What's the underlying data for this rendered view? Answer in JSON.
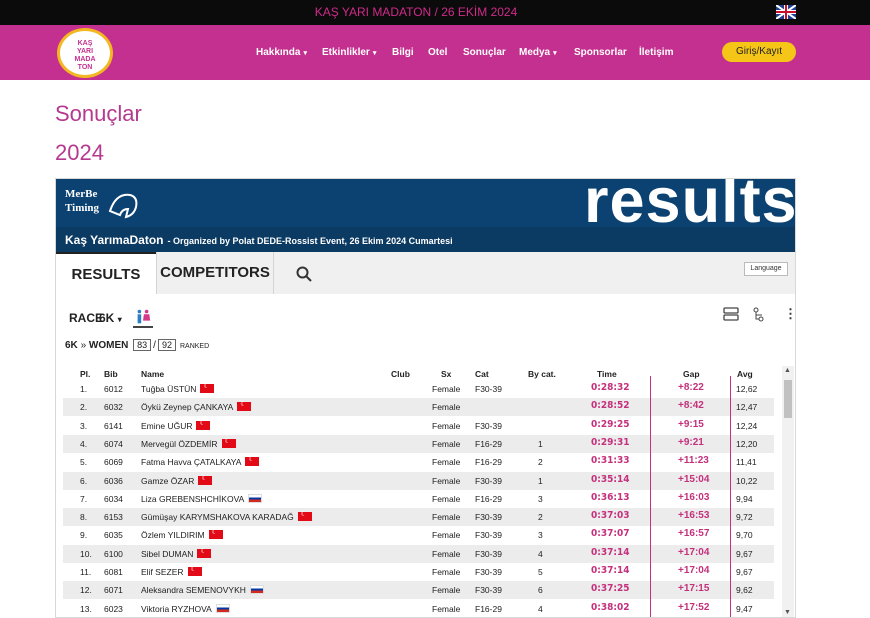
{
  "topbar": {
    "event_text": "KAŞ YARI MADATON / 26 EKİM 2024"
  },
  "logo": {
    "lines": [
      "KAŞ",
      "YARI",
      "MADA",
      "TON"
    ]
  },
  "nav": {
    "items": [
      {
        "label": "Hakkında",
        "dropdown": true
      },
      {
        "label": "Etkinlikler",
        "dropdown": true
      },
      {
        "label": "Bilgi",
        "dropdown": false
      },
      {
        "label": "Otel",
        "dropdown": false
      },
      {
        "label": "Sonuçlar",
        "dropdown": false
      },
      {
        "label": "Medya",
        "dropdown": true
      },
      {
        "label": "Sponsorlar",
        "dropdown": false
      },
      {
        "label": "İletişim",
        "dropdown": false
      }
    ],
    "login_label": "Giriş/Kayıt"
  },
  "page": {
    "title": "Sonuçlar",
    "year": "2024"
  },
  "widget": {
    "brand_line1": "MerBe",
    "brand_line2": "Timing",
    "banner_word": "results",
    "event_name": "Kaş YarımaDaton",
    "event_org": "- Organized by Polat DEDE-Rossist Event, 26 Ekim 2024 Cumartesi",
    "tabs": [
      "RESULTS",
      "COMPETITORS"
    ],
    "language_label": "Language",
    "race_label": "RACE",
    "race_value": "6K",
    "category_race": "6K",
    "category_name": "WOMEN",
    "count_ranked": "83",
    "count_total": "92",
    "ranked_label": "RANKED"
  },
  "table": {
    "headers": [
      "Pl.",
      "Bib",
      "Name",
      "Club",
      "Sx",
      "Cat",
      "By cat.",
      "Time",
      "Gap",
      "Avg"
    ],
    "rows": [
      {
        "pl": "1.",
        "bib": "6012",
        "name": "Tuğba ÜSTÜN",
        "flag": "tr",
        "sx": "Female",
        "cat": "F30-39",
        "bycat": "",
        "time": "0:28:32",
        "gap": "+8:22",
        "avg": "12,62"
      },
      {
        "pl": "2.",
        "bib": "6032",
        "name": "Öykü Zeynep ÇANKAYA",
        "flag": "tr",
        "sx": "Female",
        "cat": "",
        "bycat": "",
        "time": "0:28:52",
        "gap": "+8:42",
        "avg": "12,47"
      },
      {
        "pl": "3.",
        "bib": "6141",
        "name": "Emine UĞUR",
        "flag": "tr",
        "sx": "Female",
        "cat": "F30-39",
        "bycat": "",
        "time": "0:29:25",
        "gap": "+9:15",
        "avg": "12,24"
      },
      {
        "pl": "4.",
        "bib": "6074",
        "name": "Mervegül ÖZDEMİR",
        "flag": "tr",
        "sx": "Female",
        "cat": "F16-29",
        "bycat": "1",
        "time": "0:29:31",
        "gap": "+9:21",
        "avg": "12,20"
      },
      {
        "pl": "5.",
        "bib": "6069",
        "name": "Fatma Havva ÇATALKAYA",
        "flag": "tr",
        "sx": "Female",
        "cat": "F16-29",
        "bycat": "2",
        "time": "0:31:33",
        "gap": "+11:23",
        "avg": "11,41"
      },
      {
        "pl": "6.",
        "bib": "6036",
        "name": "Gamze ÖZAR",
        "flag": "tr",
        "sx": "Female",
        "cat": "F30-39",
        "bycat": "1",
        "time": "0:35:14",
        "gap": "+15:04",
        "avg": "10,22"
      },
      {
        "pl": "7.",
        "bib": "6034",
        "name": "Liza GREBENSHCHİKOVA",
        "flag": "ru",
        "sx": "Female",
        "cat": "F16-29",
        "bycat": "3",
        "time": "0:36:13",
        "gap": "+16:03",
        "avg": "9,94"
      },
      {
        "pl": "8.",
        "bib": "6153",
        "name": "Gümüşay KARYMSHAKOVA KARADAĞ",
        "flag": "tr",
        "sx": "Female",
        "cat": "F30-39",
        "bycat": "2",
        "time": "0:37:03",
        "gap": "+16:53",
        "avg": "9,72"
      },
      {
        "pl": "9.",
        "bib": "6035",
        "name": "Özlem YILDIRIM",
        "flag": "tr",
        "sx": "Female",
        "cat": "F30-39",
        "bycat": "3",
        "time": "0:37:07",
        "gap": "+16:57",
        "avg": "9,70"
      },
      {
        "pl": "10.",
        "bib": "6100",
        "name": "Sibel DUMAN",
        "flag": "tr",
        "sx": "Female",
        "cat": "F30-39",
        "bycat": "4",
        "time": "0:37:14",
        "gap": "+17:04",
        "avg": "9,67"
      },
      {
        "pl": "11.",
        "bib": "6081",
        "name": "Elif SEZER",
        "flag": "tr",
        "sx": "Female",
        "cat": "F30-39",
        "bycat": "5",
        "time": "0:37:14",
        "gap": "+17:04",
        "avg": "9,67"
      },
      {
        "pl": "12.",
        "bib": "6071",
        "name": "Aleksandra SEMENOVYKH",
        "flag": "ru",
        "sx": "Female",
        "cat": "F30-39",
        "bycat": "6",
        "time": "0:37:25",
        "gap": "+17:15",
        "avg": "9,62"
      },
      {
        "pl": "13.",
        "bib": "6023",
        "name": "Viktoria RYZHOVA",
        "flag": "ru",
        "sx": "Female",
        "cat": "F16-29",
        "bycat": "4",
        "time": "0:38:02",
        "gap": "+17:52",
        "avg": "9,47"
      }
    ]
  },
  "colors": {
    "brand_pink": "#c4308f",
    "time_pink": "#c4307c",
    "banner_blue": "#0c4271",
    "login_yellow": "#f5c518"
  }
}
